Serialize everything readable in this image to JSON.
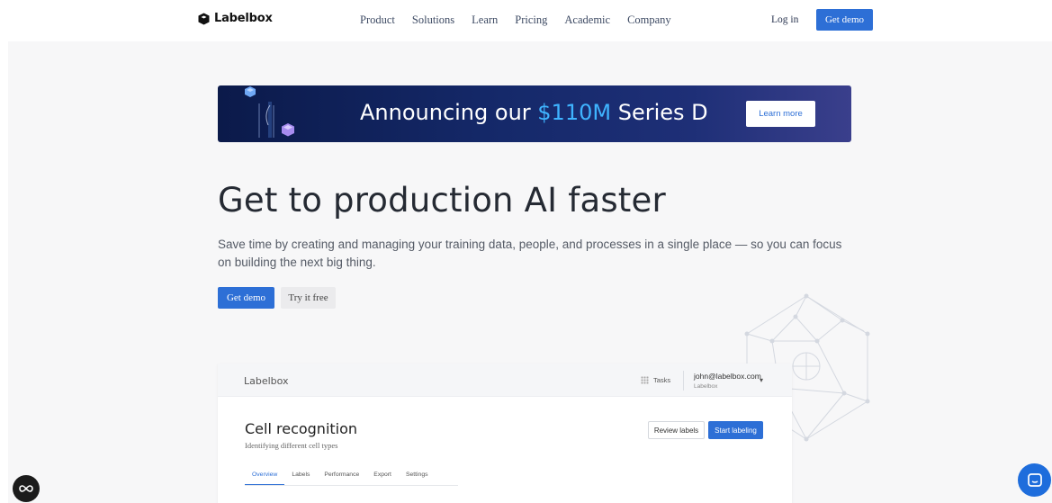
{
  "header": {
    "brand": "Labelbox",
    "nav": [
      "Product",
      "Solutions",
      "Learn",
      "Pricing",
      "Academic",
      "Company"
    ],
    "login": "Log in",
    "cta": "Get demo"
  },
  "banner": {
    "prefix": "Announcing our ",
    "amount": "$110M",
    "suffix": " Series D",
    "button": "Learn more",
    "accent_color": "#3fb4ff"
  },
  "hero": {
    "headline": "Get to production AI faster",
    "subtitle": "Save time by creating and managing your training data, people, and processes in a single place — so you can focus on building the next big thing.",
    "primary_button": "Get demo",
    "secondary_button": "Try it free"
  },
  "app_preview": {
    "logo": "Labelbox",
    "tasks": "Tasks",
    "user_email": "john@labelbox.com",
    "user_org": "Labelbox",
    "project_title": "Cell recognition",
    "project_subtitle": "Identifying different cell types",
    "review_button": "Review labels",
    "start_button": "Start labeling",
    "tabs": [
      "Overview",
      "Labels",
      "Performance",
      "Export",
      "Settings"
    ],
    "active_tab": "Overview"
  },
  "colors": {
    "brand_blue": "#2d6fd6",
    "banner_dark": "#0b1a4a",
    "chat_blue": "#1e6ddc"
  },
  "icons": {
    "left_widget": "infinity-icon",
    "right_widget": "chat-icon"
  }
}
